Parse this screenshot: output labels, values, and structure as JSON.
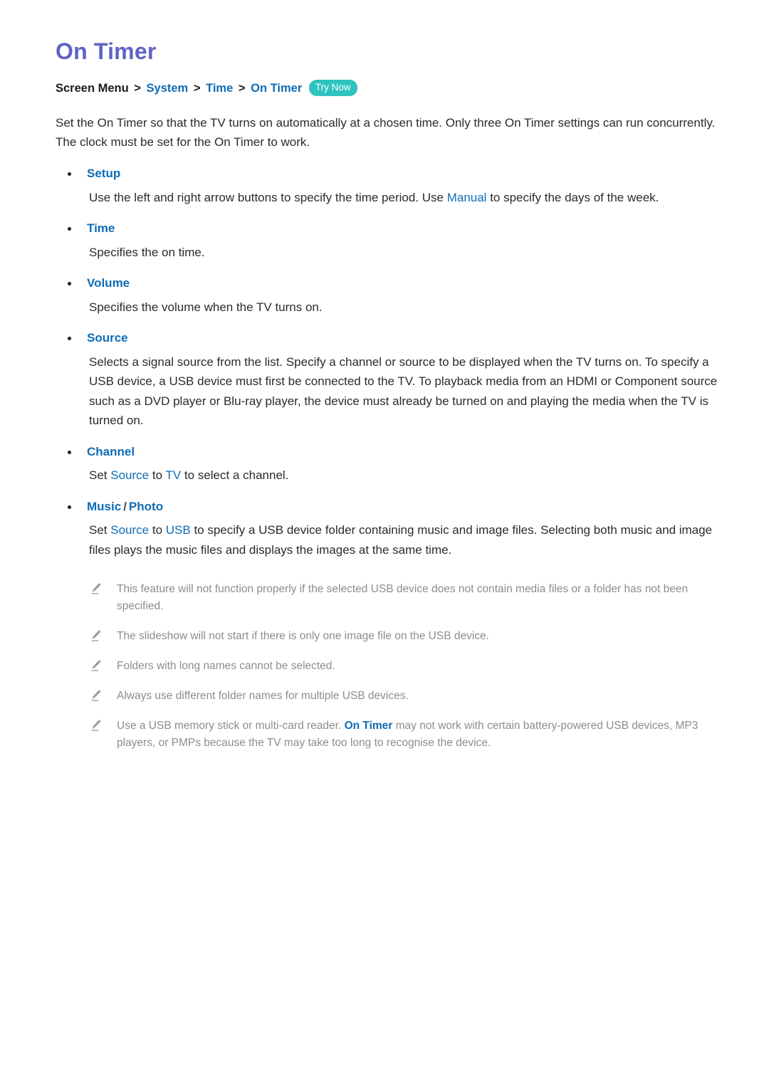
{
  "page": {
    "title": "On Timer"
  },
  "breadcrumb": {
    "root": "Screen Menu",
    "sep": ">",
    "links": [
      "System",
      "Time",
      "On Timer"
    ],
    "badge": "Try Now"
  },
  "intro": "Set the On Timer so that the TV turns on automatically at a chosen time. Only three On Timer settings can run concurrently. The clock must be set for the On Timer to work.",
  "sections": [
    {
      "heading": "Setup",
      "body_pre": "Use the left and right arrow buttons to specify the time period. Use ",
      "kw1": "Manual",
      "body_mid": " to specify the days of the week.",
      "kw2": "",
      "body_post": ""
    },
    {
      "heading": "Time",
      "body_pre": "Specifies the on time.",
      "kw1": "",
      "body_mid": "",
      "kw2": "",
      "body_post": ""
    },
    {
      "heading": "Volume",
      "body_pre": "Specifies the volume when the TV turns on.",
      "kw1": "",
      "body_mid": "",
      "kw2": "",
      "body_post": ""
    },
    {
      "heading": "Source",
      "body_pre": "Selects a signal source from the list. Specify a channel or source to be displayed when the TV turns on. To specify a USB device, a USB device must first be connected to the TV. To playback media from an HDMI or Component source such as a DVD player or Blu-ray player, the device must already be turned on and playing the media when the TV is turned on.",
      "kw1": "",
      "body_mid": "",
      "kw2": "",
      "body_post": ""
    },
    {
      "heading": "Channel",
      "body_pre": "Set ",
      "kw1": "Source",
      "body_mid": " to ",
      "kw2": "TV",
      "body_post": " to select a channel."
    },
    {
      "heading_part1": "Music",
      "heading_slash": "/",
      "heading_part2": "Photo",
      "heading": "Music / Photo",
      "body_pre": "Set ",
      "kw1": "Source",
      "body_mid": " to ",
      "kw2": "USB",
      "body_post": " to specify a USB device folder containing music and image files. Selecting both music and image files plays the music files and displays the images at the same time."
    }
  ],
  "notes": [
    {
      "pre": "This feature will not function properly if the selected USB device does not contain media files or a folder has not been specified.",
      "kw": "",
      "post": ""
    },
    {
      "pre": "The slideshow will not start if there is only one image file on the USB device.",
      "kw": "",
      "post": ""
    },
    {
      "pre": "Folders with long names cannot be selected.",
      "kw": "",
      "post": ""
    },
    {
      "pre": "Always use different folder names for multiple USB devices.",
      "kw": "",
      "post": ""
    },
    {
      "pre": "Use a USB memory stick or multi-card reader. ",
      "kw": "On Timer",
      "post": " may not work with certain battery-powered USB devices, MP3 players, or PMPs because the TV may take too long to recognise the device."
    }
  ],
  "colors": {
    "title": "#5f63c4",
    "link": "#0f6cb5",
    "badge_bg": "#2ec3c0",
    "note_text": "#8d8d8d",
    "body_text": "#2b2b2b"
  }
}
